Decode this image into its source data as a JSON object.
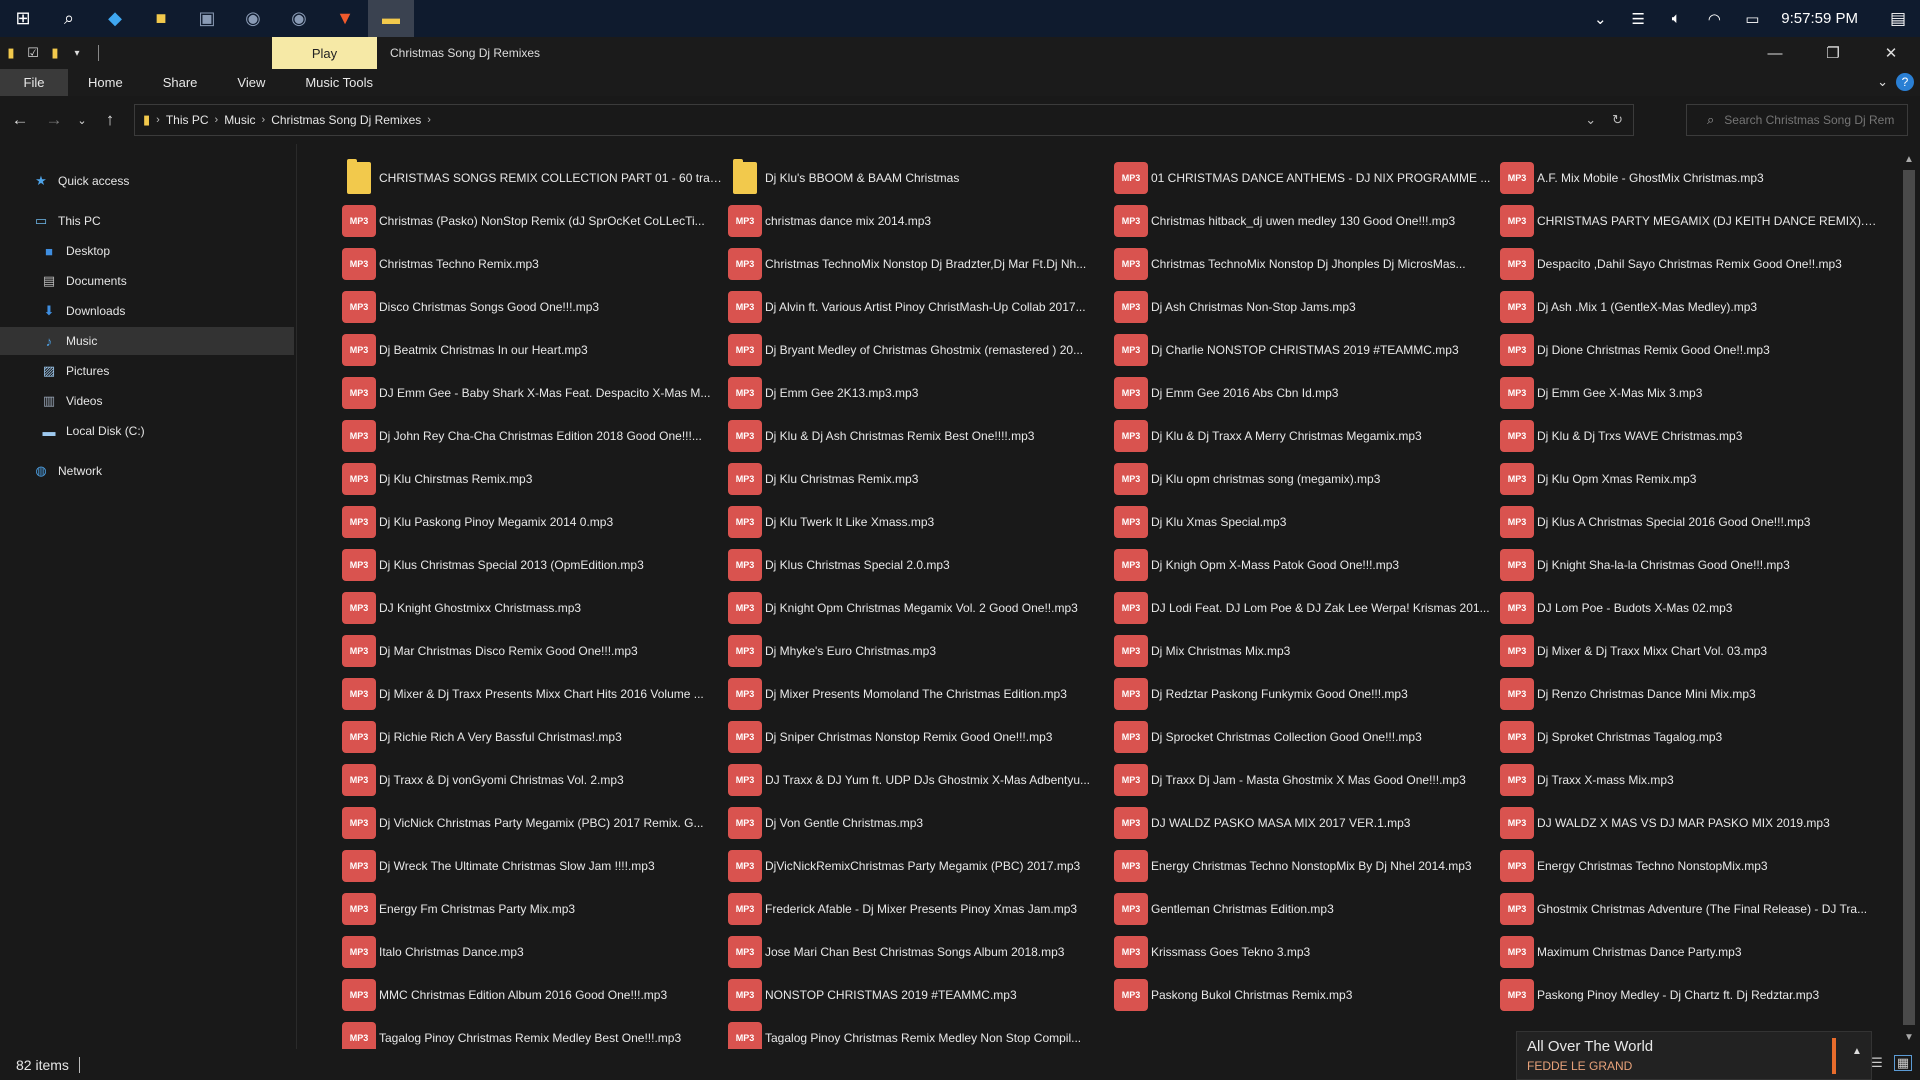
{
  "taskbar": {
    "clock": "9:57:59 PM"
  },
  "window": {
    "title": "Christmas Song Dj Remixes",
    "context_tab": "Play"
  },
  "ribbon": {
    "tabs": [
      "File",
      "Home",
      "Share",
      "View",
      "Music Tools"
    ]
  },
  "address": {
    "crumbs": [
      "This PC",
      "Music",
      "Christmas Song Dj Remixes"
    ]
  },
  "search": {
    "placeholder": "Search Christmas Song Dj Rem..."
  },
  "sidebar": {
    "items": [
      {
        "label": "Quick access",
        "icon": "star-icon"
      },
      {
        "label": "This PC",
        "icon": "computer-icon"
      },
      {
        "label": "Desktop",
        "icon": "desktop-icon"
      },
      {
        "label": "Documents",
        "icon": "documents-icon"
      },
      {
        "label": "Downloads",
        "icon": "download-icon"
      },
      {
        "label": "Music",
        "icon": "music-icon"
      },
      {
        "label": "Pictures",
        "icon": "pictures-icon"
      },
      {
        "label": "Videos",
        "icon": "videos-icon"
      },
      {
        "label": "Local Disk (C:)",
        "icon": "disk-icon"
      },
      {
        "label": "Network",
        "icon": "network-icon"
      }
    ]
  },
  "files": {
    "badge": "MP3",
    "items": [
      {
        "name": "CHRISTMAS SONGS REMIX COLLECTION PART 01 - 60 tracks",
        "type": "folder"
      },
      {
        "name": "Dj Klu's BBOOM & BAAM Christmas",
        "type": "folder"
      },
      {
        "name": "01 CHRISTMAS DANCE ANTHEMS - DJ NIX PROGRAMME ...",
        "type": "mp3"
      },
      {
        "name": "A.F. Mix Mobile - GhostMix Christmas.mp3",
        "type": "mp3"
      },
      {
        "name": "Christmas (Pasko) NonStop Remix (dJ SprOcKet CoLLecTi...",
        "type": "mp3"
      },
      {
        "name": "christmas dance mix 2014.mp3",
        "type": "mp3"
      },
      {
        "name": "Christmas hitback_dj uwen medley 130 Good One!!!.mp3",
        "type": "mp3"
      },
      {
        "name": "CHRISTMAS PARTY MEGAMIX (DJ KEITH DANCE REMIX).m...",
        "type": "mp3"
      },
      {
        "name": "Christmas Techno Remix.mp3",
        "type": "mp3"
      },
      {
        "name": "Christmas TechnoMix Nonstop Dj Bradzter,Dj Mar Ft.Dj Nh...",
        "type": "mp3"
      },
      {
        "name": "Christmas TechnoMix Nonstop Dj Jhonples Dj MicrosMas...",
        "type": "mp3"
      },
      {
        "name": "Despacito ,Dahil Sayo  Christmas Remix Good One!!.mp3",
        "type": "mp3"
      },
      {
        "name": "Disco Christmas Songs Good One!!!.mp3",
        "type": "mp3"
      },
      {
        "name": "Dj Alvin ft. Various Artist Pinoy ChristMash-Up Collab 2017...",
        "type": "mp3"
      },
      {
        "name": "Dj Ash  Christmas  Non-Stop  Jams.mp3",
        "type": "mp3"
      },
      {
        "name": "Dj Ash .Mix 1 (GentleX-Mas Medley).mp3",
        "type": "mp3"
      },
      {
        "name": "Dj Beatmix Christmas In our Heart.mp3",
        "type": "mp3"
      },
      {
        "name": "Dj Bryant  Medley of Christmas Ghostmix (remastered ) 20...",
        "type": "mp3"
      },
      {
        "name": "Dj Charlie NONSTOP CHRISTMAS 2019 #TEAMMC.mp3",
        "type": "mp3"
      },
      {
        "name": "Dj Dione Christmas Remix Good One!!.mp3",
        "type": "mp3"
      },
      {
        "name": "DJ Emm Gee - Baby Shark X-Mas Feat. Despacito X-Mas M...",
        "type": "mp3"
      },
      {
        "name": "Dj Emm Gee 2K13.mp3.mp3",
        "type": "mp3"
      },
      {
        "name": "Dj Emm Gee 2016 Abs Cbn Id.mp3",
        "type": "mp3"
      },
      {
        "name": "Dj Emm Gee X-Mas Mix 3.mp3",
        "type": "mp3"
      },
      {
        "name": "Dj John Rey Cha-Cha  Christmas  Edition 2018 Good One!!!...",
        "type": "mp3"
      },
      {
        "name": "Dj Klu & Dj Ash Christmas Remix Best One!!!!.mp3",
        "type": "mp3"
      },
      {
        "name": "Dj Klu & Dj Traxx A Merry Christmas Megamix.mp3",
        "type": "mp3"
      },
      {
        "name": "Dj Klu & Dj Trxs WAVE Christmas.mp3",
        "type": "mp3"
      },
      {
        "name": "Dj Klu Chirstmas Remix.mp3",
        "type": "mp3"
      },
      {
        "name": "Dj Klu Christmas Remix.mp3",
        "type": "mp3"
      },
      {
        "name": "Dj Klu opm christmas song (megamix).mp3",
        "type": "mp3"
      },
      {
        "name": "Dj Klu Opm Xmas Remix.mp3",
        "type": "mp3"
      },
      {
        "name": "Dj Klu Paskong Pinoy Megamix 2014 0.mp3",
        "type": "mp3"
      },
      {
        "name": "Dj Klu Twerk It Like Xmass.mp3",
        "type": "mp3"
      },
      {
        "name": "Dj Klu Xmas Special.mp3",
        "type": "mp3"
      },
      {
        "name": "Dj Klus A Christmas Special 2016 Good One!!!.mp3",
        "type": "mp3"
      },
      {
        "name": "Dj Klus Christmas  Special  2013  (OpmEdition.mp3",
        "type": "mp3"
      },
      {
        "name": "Dj Klus Christmas Special 2.0.mp3",
        "type": "mp3"
      },
      {
        "name": "Dj Knigh Opm X-Mass Patok Good One!!!.mp3",
        "type": "mp3"
      },
      {
        "name": "Dj Knight  Sha-la-la Christmas Good One!!!.mp3",
        "type": "mp3"
      },
      {
        "name": "DJ Knight Ghostmixx Christmass.mp3",
        "type": "mp3"
      },
      {
        "name": "Dj Knight Opm Christmas Megamix Vol. 2 Good One!!.mp3",
        "type": "mp3"
      },
      {
        "name": "DJ Lodi Feat. DJ Lom Poe & DJ Zak Lee Werpa! Krismas 201...",
        "type": "mp3"
      },
      {
        "name": "DJ Lom Poe - Budots X-Mas 02.mp3",
        "type": "mp3"
      },
      {
        "name": "Dj Mar Christmas Disco Remix Good One!!!.mp3",
        "type": "mp3"
      },
      {
        "name": "Dj Mhyke's Euro Christmas.mp3",
        "type": "mp3"
      },
      {
        "name": "Dj Mix Christmas  Mix.mp3",
        "type": "mp3"
      },
      {
        "name": "Dj Mixer & Dj Traxx Mixx Chart Vol. 03.mp3",
        "type": "mp3"
      },
      {
        "name": "Dj Mixer & Dj Traxx Presents Mixx Chart Hits 2016 Volume ...",
        "type": "mp3"
      },
      {
        "name": "Dj Mixer Presents Momoland The Christmas Edition.mp3",
        "type": "mp3"
      },
      {
        "name": "Dj Redztar Paskong Funkymix Good One!!!.mp3",
        "type": "mp3"
      },
      {
        "name": "Dj Renzo Christmas Dance  Mini Mix.mp3",
        "type": "mp3"
      },
      {
        "name": "Dj Richie Rich  A Very Bassful Christmas!.mp3",
        "type": "mp3"
      },
      {
        "name": "Dj Sniper Christmas Nonstop Remix Good One!!!.mp3",
        "type": "mp3"
      },
      {
        "name": "Dj Sprocket Christmas Collection Good One!!!.mp3",
        "type": "mp3"
      },
      {
        "name": "Dj Sproket Christmas  Tagalog.mp3",
        "type": "mp3"
      },
      {
        "name": "Dj Traxx & Dj vonGyomi  Christmas Vol. 2.mp3",
        "type": "mp3"
      },
      {
        "name": "DJ Traxx & DJ Yum ft. UDP DJs Ghostmix X-Mas Adbentyu...",
        "type": "mp3"
      },
      {
        "name": "Dj Traxx Dj Jam - Masta Ghostmix X Mas Good One!!!.mp3",
        "type": "mp3"
      },
      {
        "name": "Dj Traxx X-mass Mix.mp3",
        "type": "mp3"
      },
      {
        "name": "Dj VicNick Christmas Party Megamix (PBC) 2017 Remix. G...",
        "type": "mp3"
      },
      {
        "name": "Dj Von Gentle Christmas.mp3",
        "type": "mp3"
      },
      {
        "name": "DJ WALDZ PASKO MASA MIX 2017 VER.1.mp3",
        "type": "mp3"
      },
      {
        "name": "DJ WALDZ X MAS VS DJ MAR PASKO MIX 2019.mp3",
        "type": "mp3"
      },
      {
        "name": "Dj Wreck The Ultimate Christmas Slow Jam !!!!.mp3",
        "type": "mp3"
      },
      {
        "name": "DjVicNickRemixChristmas Party Megamix (PBC) 2017.mp3",
        "type": "mp3"
      },
      {
        "name": "Energy Christmas Techno NonstopMix By Dj Nhel 2014.mp3",
        "type": "mp3"
      },
      {
        "name": "Energy Christmas Techno NonstopMix.mp3",
        "type": "mp3"
      },
      {
        "name": "Energy Fm Christmas Party Mix.mp3",
        "type": "mp3"
      },
      {
        "name": "Frederick Afable - Dj Mixer Presents Pinoy Xmas Jam.mp3",
        "type": "mp3"
      },
      {
        "name": "Gentleman Christmas Edition.mp3",
        "type": "mp3"
      },
      {
        "name": "Ghostmix Christmas Adventure (The Final Release) - DJ Tra...",
        "type": "mp3"
      },
      {
        "name": "Italo Christmas Dance.mp3",
        "type": "mp3"
      },
      {
        "name": "Jose Mari Chan Best Christmas Songs Album 2018.mp3",
        "type": "mp3"
      },
      {
        "name": "Krissmass Goes Tekno 3.mp3",
        "type": "mp3"
      },
      {
        "name": "Maximum Christmas Dance Party.mp3",
        "type": "mp3"
      },
      {
        "name": "MMC Christmas Edition Album 2016 Good One!!!.mp3",
        "type": "mp3"
      },
      {
        "name": "NONSTOP CHRISTMAS 2019 #TEAMMC.mp3",
        "type": "mp3"
      },
      {
        "name": "Paskong Bukol Christmas Remix.mp3",
        "type": "mp3"
      },
      {
        "name": "Paskong Pinoy Medley - Dj Chartz ft. Dj Redztar.mp3",
        "type": "mp3"
      },
      {
        "name": "Tagalog Pinoy Christmas Remix Medley Best One!!!.mp3",
        "type": "mp3"
      },
      {
        "name": "Tagalog Pinoy Christmas Remix Medley Non Stop Compil...",
        "type": "mp3"
      }
    ]
  },
  "status": {
    "count": "82 items"
  },
  "player": {
    "title": "All Over The World",
    "artist": "FEDDE LE GRAND"
  },
  "colors": {
    "mp3_badge": "#d9534f",
    "folder": "#f2c94c",
    "accent": "#2a7fd4"
  }
}
